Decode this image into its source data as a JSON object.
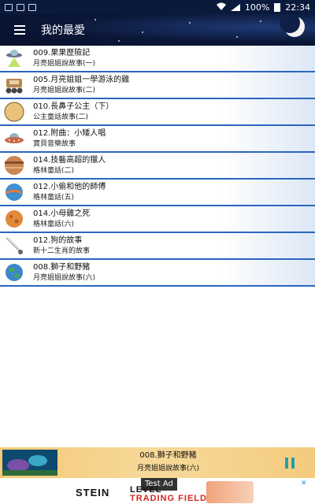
{
  "status_bar": {
    "battery": "100%",
    "time": "22:34"
  },
  "app_bar": {
    "title": "我的最愛"
  },
  "favorites": [
    {
      "title": "009.果果歷險記",
      "subtitle": "月亮姐姐說故事(一)",
      "icon": "ufo-icon"
    },
    {
      "title": "005.月亮姐姐一學游泳的雞",
      "subtitle": "月亮姐姐說故事(二)",
      "icon": "rover-icon"
    },
    {
      "title": "010.長鼻子公主（下）",
      "subtitle": "公主童話故事(二)",
      "icon": "moon-planet-icon"
    },
    {
      "title": "012.附曲：小矮人唱",
      "subtitle": "寶貝音樂故事",
      "icon": "flying-saucer-icon"
    },
    {
      "title": "014.技藝高超的獵人",
      "subtitle": "格林童話(二)",
      "icon": "jupiter-icon"
    },
    {
      "title": "012.小偷和他的師傅",
      "subtitle": "格林童話(五)",
      "icon": "neptune-icon"
    },
    {
      "title": "014.小母雞之死",
      "subtitle": "格林童話(六)",
      "icon": "mars-icon"
    },
    {
      "title": "012.狗的故事",
      "subtitle": "新十二生肖的故事",
      "icon": "comet-icon"
    },
    {
      "title": "008.獅子和野豬",
      "subtitle": "月亮姐姐說故事(六)",
      "icon": "earth-icon"
    }
  ],
  "player": {
    "title": "008.獅子和野豬",
    "subtitle": "月亮姐姐說故事(六)"
  },
  "ad": {
    "label": "Test Ad",
    "brand": "STEIN",
    "line1": "LEVEL",
    "line2": "TRADING FIELD"
  },
  "colors": {
    "appbar": "#0b1738",
    "divider": "#2a66c0",
    "player_bg": "#f4c976",
    "pause": "#1e9fb0"
  }
}
